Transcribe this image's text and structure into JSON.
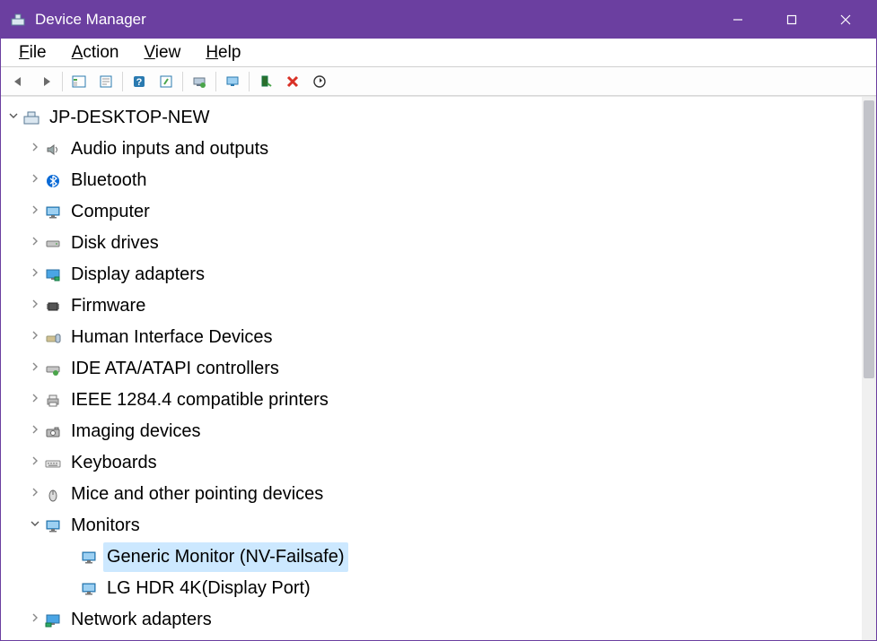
{
  "window": {
    "title": "Device Manager"
  },
  "menu": {
    "file": "File",
    "action": "Action",
    "view": "View",
    "help": "Help"
  },
  "toolbar": {
    "back": "Back",
    "forward": "Forward",
    "show_hide": "Show/Hide Console Tree",
    "properties": "Properties",
    "help": "Help",
    "action_center": "Action",
    "update": "Update Driver",
    "scan": "Scan for hardware changes",
    "uninstall": "Uninstall device",
    "disable": "Disable device",
    "remove": "Remove"
  },
  "tree": {
    "root": {
      "label": "JP-DESKTOP-NEW",
      "expanded": true
    },
    "categories": [
      {
        "id": "audio",
        "label": "Audio inputs and outputs",
        "icon": "speaker-icon"
      },
      {
        "id": "bluetooth",
        "label": "Bluetooth",
        "icon": "bluetooth-icon"
      },
      {
        "id": "computer",
        "label": "Computer",
        "icon": "monitor-icon"
      },
      {
        "id": "disk",
        "label": "Disk drives",
        "icon": "disk-icon"
      },
      {
        "id": "display",
        "label": "Display adapters",
        "icon": "display-adapter-icon"
      },
      {
        "id": "firmware",
        "label": "Firmware",
        "icon": "chip-icon"
      },
      {
        "id": "hid",
        "label": "Human Interface Devices",
        "icon": "hid-icon"
      },
      {
        "id": "ide",
        "label": "IDE ATA/ATAPI controllers",
        "icon": "ide-icon"
      },
      {
        "id": "ieee",
        "label": "IEEE 1284.4 compatible printers",
        "icon": "printer-icon"
      },
      {
        "id": "imaging",
        "label": "Imaging devices",
        "icon": "camera-icon"
      },
      {
        "id": "keyboards",
        "label": "Keyboards",
        "icon": "keyboard-icon"
      },
      {
        "id": "mice",
        "label": "Mice and other pointing devices",
        "icon": "mouse-icon"
      },
      {
        "id": "monitors",
        "label": "Monitors",
        "icon": "monitor-icon",
        "expanded": true,
        "children": [
          {
            "id": "mon1",
            "label": "Generic Monitor (NV-Failsafe)",
            "icon": "monitor-icon",
            "selected": true
          },
          {
            "id": "mon2",
            "label": "LG HDR 4K(Display Port)",
            "icon": "monitor-icon"
          }
        ]
      },
      {
        "id": "network",
        "label": "Network adapters",
        "icon": "network-icon"
      }
    ]
  }
}
